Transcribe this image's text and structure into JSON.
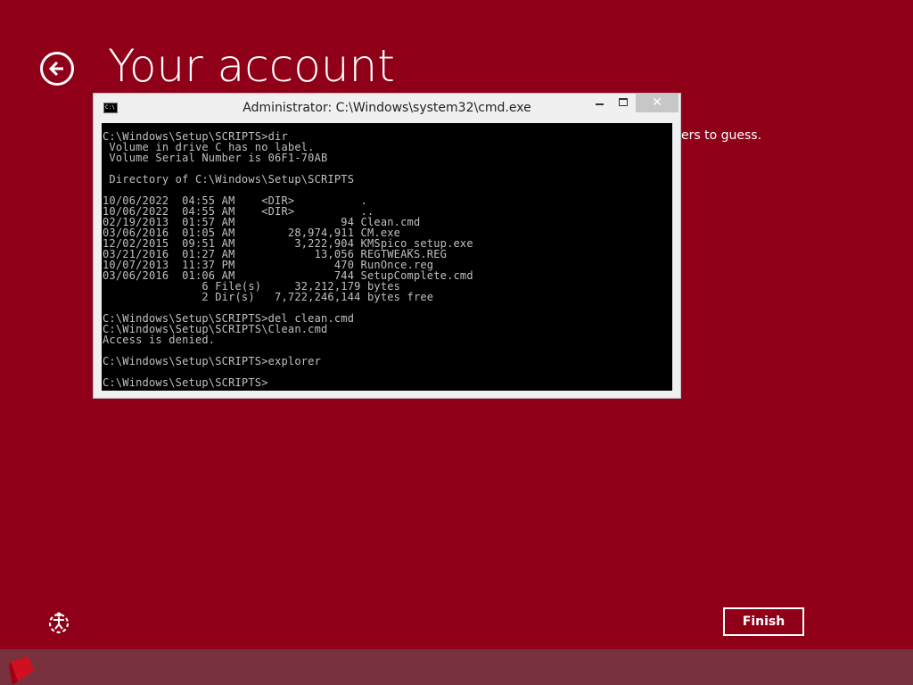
{
  "page": {
    "title": "Your account",
    "partial_text": "ers to guess.",
    "finish_label": "Finish",
    "colors": {
      "background": "#8f0018",
      "taskbar": "#79303d",
      "accent_text": "#ffffff"
    },
    "icons": {
      "back": "back-arrow-icon",
      "ease_of_access": "ease-of-access-icon",
      "taskbar": "taskbar-app-icon"
    }
  },
  "cmd": {
    "title": "Administrator: C:\\Windows\\system32\\cmd.exe",
    "icon_label": "C:\\",
    "close_glyph": "✕",
    "lines": [
      "C:\\Windows\\Setup\\SCRIPTS>dir",
      " Volume in drive C has no label.",
      " Volume Serial Number is 06F1-70AB",
      "",
      " Directory of C:\\Windows\\Setup\\SCRIPTS",
      "",
      "10/06/2022  04:55 AM    <DIR>          .",
      "10/06/2022  04:55 AM    <DIR>          ..",
      "02/19/2013  01:57 AM                94 Clean.cmd",
      "03/06/2016  01:05 AM        28,974,911 CM.exe",
      "12/02/2015  09:51 AM         3,222,904 KMSpico_setup.exe",
      "03/21/2016  01:27 AM            13,056 REGTWEAKS.REG",
      "10/07/2013  11:37 PM               470 RunOnce.reg",
      "03/06/2016  01:06 AM               744 SetupComplete.cmd",
      "               6 File(s)     32,212,179 bytes",
      "               2 Dir(s)   7,722,246,144 bytes free",
      "",
      "C:\\Windows\\Setup\\SCRIPTS>del clean.cmd",
      "C:\\Windows\\Setup\\SCRIPTS\\Clean.cmd",
      "Access is denied.",
      "",
      "C:\\Windows\\Setup\\SCRIPTS>explorer",
      "",
      "C:\\Windows\\Setup\\SCRIPTS>"
    ]
  }
}
